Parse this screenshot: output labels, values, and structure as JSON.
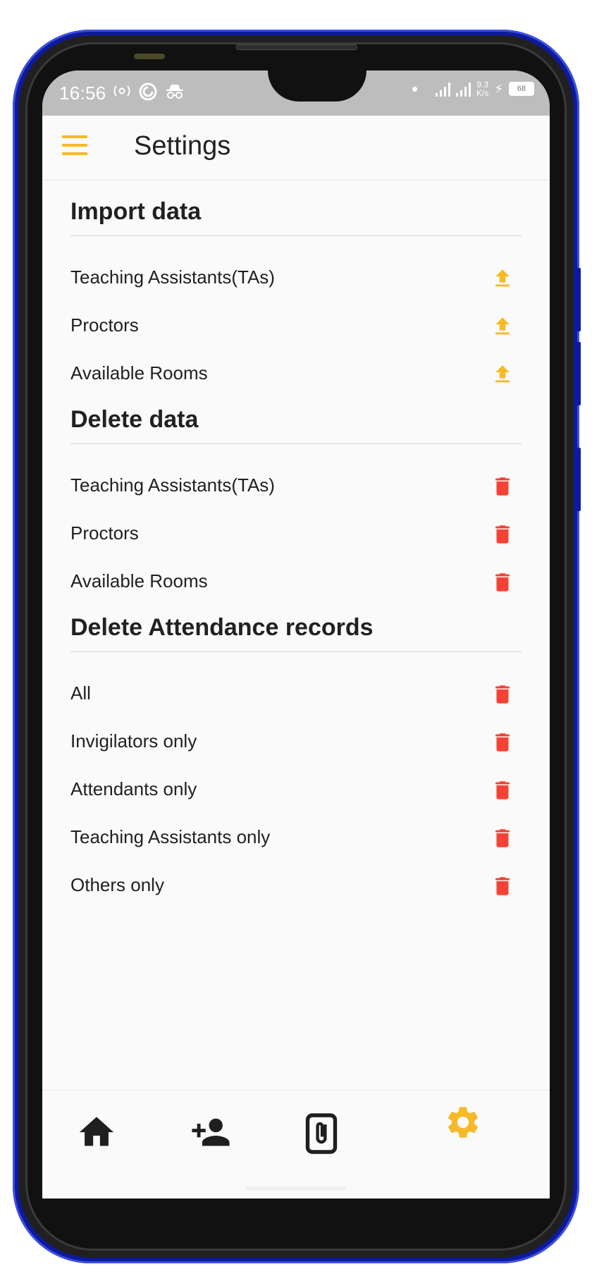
{
  "status_bar": {
    "time": "16:56",
    "net_speed_value": "9.3",
    "net_speed_unit": "K/s",
    "battery": "68"
  },
  "app_bar": {
    "title": "Settings",
    "menu_icon": "menu-icon"
  },
  "sections": [
    {
      "title": "Import data",
      "action_icon": "upload-icon",
      "action_color": "#f7b928",
      "items": [
        {
          "label": "Teaching Assistants(TAs)"
        },
        {
          "label": "Proctors"
        },
        {
          "label": "Available Rooms"
        }
      ]
    },
    {
      "title": "Delete data",
      "action_icon": "delete-icon",
      "action_color": "#f44336",
      "items": [
        {
          "label": "Teaching Assistants(TAs)"
        },
        {
          "label": "Proctors"
        },
        {
          "label": "Available Rooms"
        }
      ]
    },
    {
      "title": "Delete Attendance records",
      "action_icon": "delete-icon",
      "action_color": "#f44336",
      "items": [
        {
          "label": "All"
        },
        {
          "label": "Invigilators only"
        },
        {
          "label": "Attendants only"
        },
        {
          "label": "Teaching Assistants only"
        },
        {
          "label": "Others only"
        }
      ]
    }
  ],
  "bottom_nav": {
    "items": [
      {
        "icon": "home-icon",
        "active": false
      },
      {
        "icon": "add-person-icon",
        "active": false
      },
      {
        "icon": "attachment-icon",
        "active": false
      },
      {
        "icon": "settings-gear-icon",
        "active": true
      }
    ],
    "active_color": "#f7b928",
    "inactive_color": "#1f1f1f"
  }
}
